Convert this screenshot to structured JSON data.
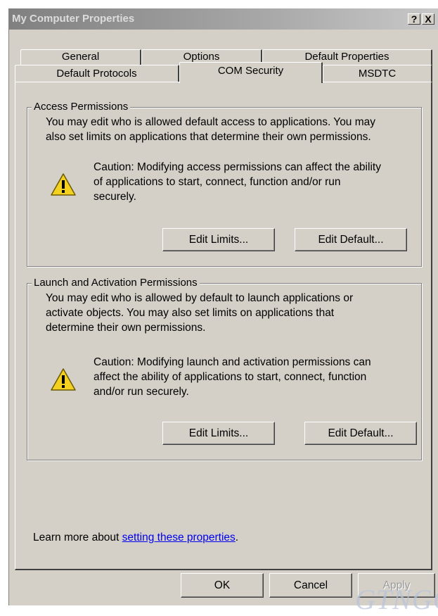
{
  "window": {
    "title": "My Computer Properties",
    "help_label": "?",
    "close_label": "X"
  },
  "tabs": {
    "row1": [
      "General",
      "Options",
      "Default Properties"
    ],
    "row2": [
      "Default Protocols",
      "COM Security",
      "MSDTC"
    ],
    "active": "COM Security"
  },
  "access": {
    "label": "Access Permissions",
    "desc_line1": "You may edit who is allowed default access to applications. You may",
    "desc_line2": "also set limits on applications that determine their own permissions.",
    "caution_line1": "Caution: Modifying access permissions can affect the ability",
    "caution_line2": "of applications to start, connect, function and/or run",
    "caution_line3": "securely.",
    "edit_limits": "Edit Limits...",
    "edit_default": "Edit Default..."
  },
  "launch": {
    "label": "Launch and Activation Permissions",
    "desc_line1": "You may edit who is allowed by default to launch applications or",
    "desc_line2": "activate objects. You may also set limits on applications that",
    "desc_line3": "determine their own permissions.",
    "caution_line1": "Caution: Modifying launch and activation permissions can",
    "caution_line2": "affect the ability of applications to start, connect, function",
    "caution_line3": "and/or run securely.",
    "edit_limits": "Edit Limits...",
    "edit_default": "Edit Default..."
  },
  "learn_more": {
    "prefix": "Learn more about ",
    "link": "setting these properties",
    "suffix": "."
  },
  "footer": {
    "ok": "OK",
    "cancel": "Cancel",
    "apply": "Apply"
  },
  "watermark": "GTNGG",
  "colors": {
    "face": "#d4d0c8",
    "link": "#0000ee",
    "title_gradient_start": "#808080"
  }
}
